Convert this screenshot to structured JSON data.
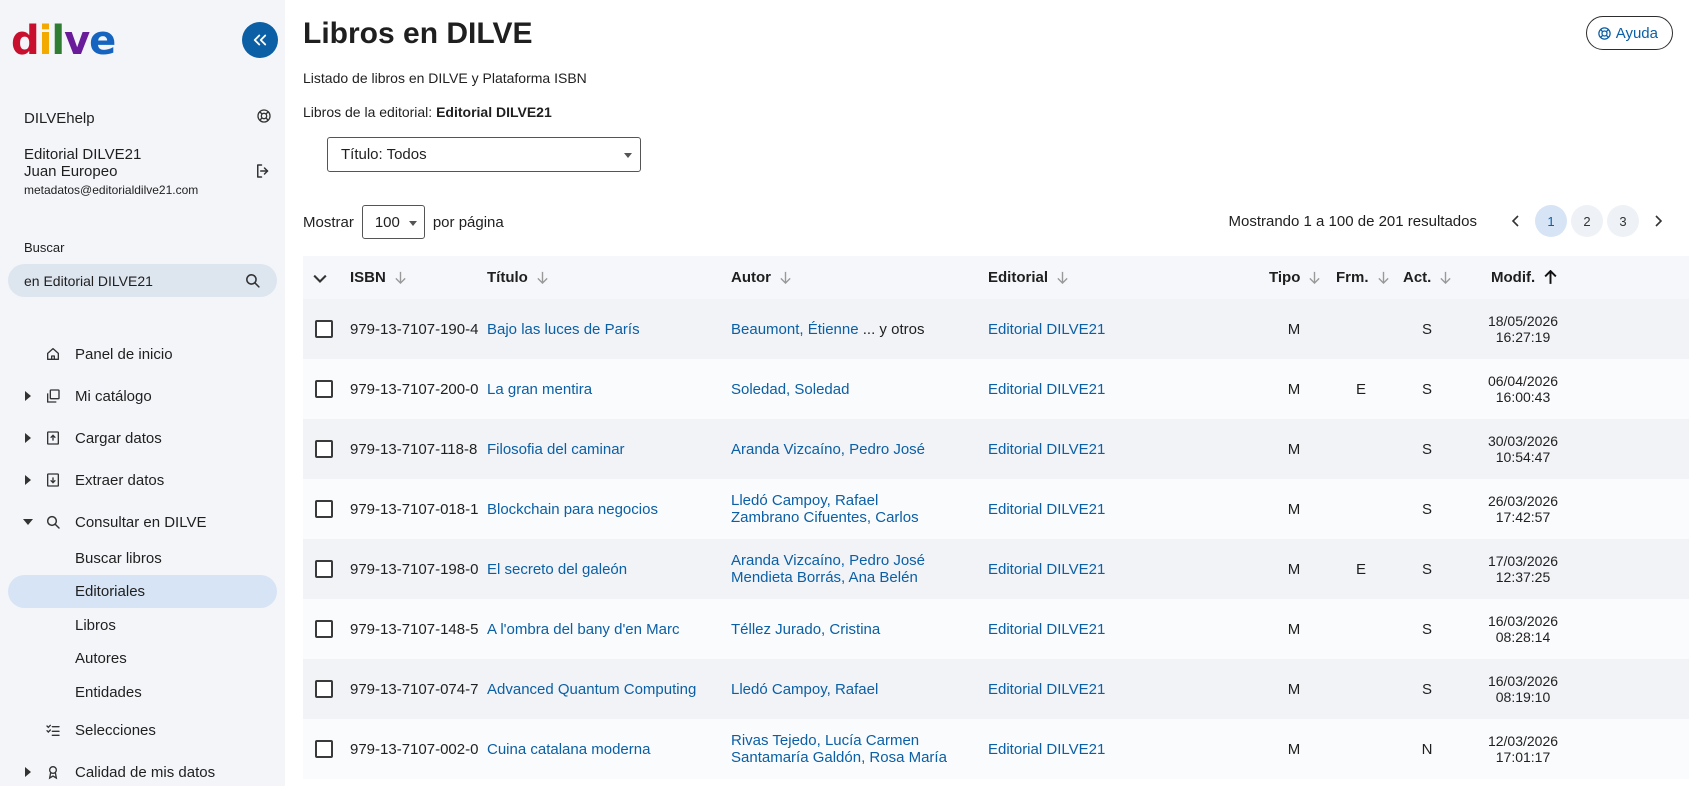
{
  "sidebar": {
    "logo": {
      "letters": [
        "d",
        "i",
        "l",
        "v",
        "e"
      ],
      "colors": [
        "#c8102e",
        "#f2a900",
        "#2e7d32",
        "#6a1b9a",
        "#1565c0"
      ]
    },
    "help_link": "DILVEhelp",
    "user": {
      "company": "Editorial DILVE21",
      "name": "Juan Europeo",
      "email": "metadatos@editorialdilve21.com"
    },
    "search_label": "Buscar",
    "search_value": "en Editorial DILVE21",
    "nav": [
      {
        "label": "Panel de inicio",
        "icon": "home-icon"
      },
      {
        "label": "Mi catálogo",
        "icon": "copy-icon"
      },
      {
        "label": "Cargar datos",
        "icon": "upload-icon"
      },
      {
        "label": "Extraer datos",
        "icon": "download-icon"
      },
      {
        "label": "Consultar en DILVE",
        "icon": "search-icon"
      }
    ],
    "sub_items": [
      "Buscar libros",
      "Editoriales",
      "Libros",
      "Autores",
      "Entidades"
    ],
    "nav_bottom": [
      {
        "label": "Selecciones",
        "icon": "checklist-icon"
      },
      {
        "label": "Calidad de mis datos",
        "icon": "award-icon"
      }
    ]
  },
  "main": {
    "title": "Libros en DILVE",
    "help_button": "Ayuda",
    "subtitle": "Listado de libros en DILVE y Plataforma ISBN",
    "editorial_prefix": "Libros de la editorial:",
    "editorial_name": "Editorial DILVE21",
    "title_filter": "Título: Todos",
    "show_label": "Mostrar",
    "per_page_value": "100",
    "per_page_suffix": "por página",
    "results_summary": "Mostrando 1 a 100 de 201 resultados",
    "pages": [
      "1",
      "2",
      "3"
    ]
  },
  "table": {
    "headers": {
      "isbn": "ISBN",
      "titulo": "Título",
      "autor": "Autor",
      "editorial": "Editorial",
      "tipo": "Tipo",
      "frm": "Frm.",
      "act": "Act.",
      "modif": "Modif."
    },
    "rows": [
      {
        "isbn": "979-13-7107-190-4",
        "titulo": "Bajo las luces de París",
        "autor1": "Beaumont, Étienne",
        "autor_more": "... y otros",
        "autor2": "",
        "editorial": "Editorial DILVE21",
        "tipo": "M",
        "frm": "",
        "act": "S",
        "date": "18/05/2026",
        "time": "16:27:19"
      },
      {
        "isbn": "979-13-7107-200-0",
        "titulo": "La gran mentira",
        "autor1": "Soledad, Soledad",
        "autor_more": "",
        "autor2": "",
        "editorial": "Editorial DILVE21",
        "tipo": "M",
        "frm": "E",
        "act": "S",
        "date": "06/04/2026",
        "time": "16:00:43"
      },
      {
        "isbn": "979-13-7107-118-8",
        "titulo": "Filosofia del caminar",
        "autor1": "Aranda Vizcaíno, Pedro José",
        "autor_more": "",
        "autor2": "",
        "editorial": "Editorial DILVE21",
        "tipo": "M",
        "frm": "",
        "act": "S",
        "date": "30/03/2026",
        "time": "10:54:47"
      },
      {
        "isbn": "979-13-7107-018-1",
        "titulo": "Blockchain para negocios",
        "autor1": "Lledó Campoy, Rafael",
        "autor_more": "",
        "autor2": "Zambrano Cifuentes, Carlos",
        "editorial": "Editorial DILVE21",
        "tipo": "M",
        "frm": "",
        "act": "S",
        "date": "26/03/2026",
        "time": "17:42:57"
      },
      {
        "isbn": "979-13-7107-198-0",
        "titulo": "El secreto del galeón",
        "autor1": "Aranda Vizcaíno, Pedro José",
        "autor_more": "",
        "autor2": "Mendieta Borrás, Ana Belén",
        "editorial": "Editorial DILVE21",
        "tipo": "M",
        "frm": "E",
        "act": "S",
        "date": "17/03/2026",
        "time": "12:37:25"
      },
      {
        "isbn": "979-13-7107-148-5",
        "titulo": "A l'ombra del bany d'en Marc",
        "autor1": "Téllez Jurado, Cristina",
        "autor_more": "",
        "autor2": "",
        "editorial": "Editorial DILVE21",
        "tipo": "M",
        "frm": "",
        "act": "S",
        "date": "16/03/2026",
        "time": "08:28:14"
      },
      {
        "isbn": "979-13-7107-074-7",
        "titulo": "Advanced Quantum Computing",
        "autor1": "Lledó Campoy, Rafael",
        "autor_more": "",
        "autor2": "",
        "editorial": "Editorial DILVE21",
        "tipo": "M",
        "frm": "",
        "act": "S",
        "date": "16/03/2026",
        "time": "08:19:10"
      },
      {
        "isbn": "979-13-7107-002-0",
        "titulo": "Cuina catalana moderna",
        "autor1": "Rivas Tejedo, Lucía Carmen",
        "autor_more": "",
        "autor2": "Santamaría Galdón, Rosa María",
        "editorial": "Editorial DILVE21",
        "tipo": "M",
        "frm": "",
        "act": "N",
        "date": "12/03/2026",
        "time": "17:01:17"
      }
    ]
  },
  "colors": {
    "accent": "#0b5fa5",
    "sidebar_bg": "#f3f5f9",
    "active_bg": "#d6e4f5"
  }
}
